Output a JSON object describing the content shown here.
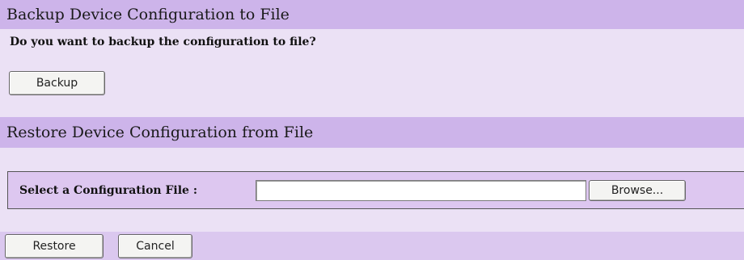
{
  "backup_section": {
    "title": "Backup Device Configuration to File",
    "question": "Do you want to backup the configuration to file?",
    "backup_button": "Backup"
  },
  "restore_section": {
    "title": "Restore Device Configuration from File",
    "select_label": "Select a Configuration File :",
    "file_value": "",
    "browse_button": "Browse..."
  },
  "actions": {
    "restore_button": "Restore",
    "cancel_button": "Cancel"
  },
  "colors": {
    "header_band": "#cdb4ea",
    "light_band": "#ebe1f5",
    "mid_band": "#dbc8ef"
  }
}
